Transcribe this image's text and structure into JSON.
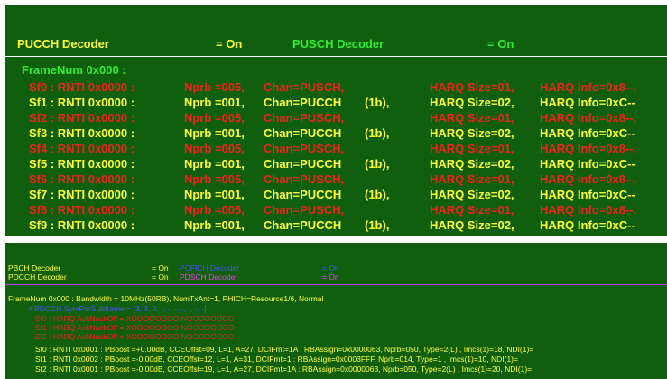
{
  "top": {
    "header": {
      "pucch_label": "PUCCH Decoder",
      "pucch_value": "= On",
      "pusch_label": "PUSCH Decoder",
      "pusch_value": "= On"
    },
    "frame_label": "FrameNum  0x000  :",
    "rows": [
      {
        "sf": "Sf0 : RNTI 0x0000 :",
        "nprb": "Nprb =005,",
        "chan": "Chan=PUSCH,",
        "fmt": "",
        "size": "HARQ  Size=01,",
        "info": "HARQ  Info=0x8--,",
        "color": "red"
      },
      {
        "sf": "Sf1 : RNTI 0x0000 :",
        "nprb": "Nprb =001,",
        "chan": "Chan=PUCCH",
        "fmt": "(1b),",
        "size": "HARQ  Size=02,",
        "info": "HARQ  Info=0xC--",
        "color": "yellow"
      },
      {
        "sf": "Sf2 : RNTI 0x0000 :",
        "nprb": "Nprb =005,",
        "chan": "Chan=PUSCH,",
        "fmt": "",
        "size": "HARQ  Size=01,",
        "info": "HARQ  Info=0x8--,",
        "color": "red"
      },
      {
        "sf": "Sf3 : RNTI 0x0000 :",
        "nprb": "Nprb =001,",
        "chan": "Chan=PUCCH",
        "fmt": "(1b),",
        "size": "HARQ  Size=02,",
        "info": "HARQ  Info=0xC--",
        "color": "yellow"
      },
      {
        "sf": "Sf4 : RNTI 0x0000 :",
        "nprb": "Nprb =005,",
        "chan": "Chan=PUSCH,",
        "fmt": "",
        "size": "HARQ  Size=01,",
        "info": "HARQ  Info=0x8--,",
        "color": "red"
      },
      {
        "sf": "Sf5 : RNTI 0x0000 :",
        "nprb": "Nprb =001,",
        "chan": "Chan=PUCCH",
        "fmt": "(1b),",
        "size": "HARQ  Size=02,",
        "info": "HARQ  Info=0xC--",
        "color": "yellow"
      },
      {
        "sf": "Sf6 : RNTI 0x0000 :",
        "nprb": "Nprb =005,",
        "chan": "Chan=PUSCH,",
        "fmt": "",
        "size": "HARQ  Size=01,",
        "info": "HARQ  Info=0x8--,",
        "color": "red"
      },
      {
        "sf": "Sf7 : RNTI 0x0000 :",
        "nprb": "Nprb =001,",
        "chan": "Chan=PUCCH",
        "fmt": "(1b),",
        "size": "HARQ  Size=02,",
        "info": "HARQ  Info=0xC--",
        "color": "yellow"
      },
      {
        "sf": "Sf8 : RNTI 0x0000 :",
        "nprb": "Nprb =005,",
        "chan": "Chan=PUSCH,",
        "fmt": "",
        "size": "HARQ  Size=01,",
        "info": "HARQ  Info=0x8--,",
        "color": "red"
      },
      {
        "sf": "Sf9 : RNTI 0x0000 :",
        "nprb": "Nprb =001,",
        "chan": "Chan=PUCCH",
        "fmt": "(1b),",
        "size": "HARQ  Size=02,",
        "info": "HARQ  Info=0xC--",
        "color": "yellow"
      }
    ]
  },
  "bottom": {
    "pbch_label": "PBCH Decoder",
    "pbch_value": "= On",
    "pcfich_label": "PCFICH Decoder",
    "pcfich_value": "= On",
    "pdcch_label": "PDCCH Decoder",
    "pdcch_value": "= On",
    "pdsch_label": "PDSCH Decoder",
    "pdsch_value": "= On",
    "frame_line": "FrameNum 0x000 :     Bandwidth = 10MHz(50RB),   NumTxAnt=1, PHICH=Resource1/6,    Normal",
    "sym_line": "# PDCCH SymPerSubframe = [3,   3,   3,   -,   -,   -,   -,   -,   -,   -]",
    "harq_lines": [
      "Sf0 : HARQ AckNackOff    = XOOOOOOOO   NOOOOOOOO",
      "Sf1 : HARQ AckNackOff    = XOOOOOOOO   NOOOOOOOO",
      "Sf2 : HARQ AckNackOff    = XOOOOOOOO   NOOOOOOOO"
    ],
    "dci_lines": [
      "Sf0 : RNTI 0x0001 : PBoost =+0.00dB,   CCEOffst=09,  L=1,  A=27,  DCIFmt=1A   :  RBAssign=0x0000063,  Nprb=050,  Type=2(L)   ,  Imcs(1)=18,    NDI(1)=",
      "Sf1 : RNTI 0x0002 : PBoost =-0.00dB,   CCEOffst=12,  L=1,  A=31,  DCIFmt=1    :  RBAssign=0x0003FFF, Nprb=014,  Type=1       ,  Imcs(1)=10,    NDI(1)=",
      "Sf2 : RNTI 0x0001 : PBoost =-0.00dB,   CCEOffst=19,  L=1,  A=27,  DCIFmt=1A   :  RBAssign=0x0000063,  Nprb=050,  Type=2(L)   ,  Imcs(1)=20,    NDI(1)="
    ]
  },
  "colors": {
    "panel_bg": "#0f5f0f",
    "yellow": "#ffff33",
    "green": "#33ee33",
    "red": "#ee2222",
    "blue": "#5050ff",
    "magenta": "#ff33ff"
  }
}
